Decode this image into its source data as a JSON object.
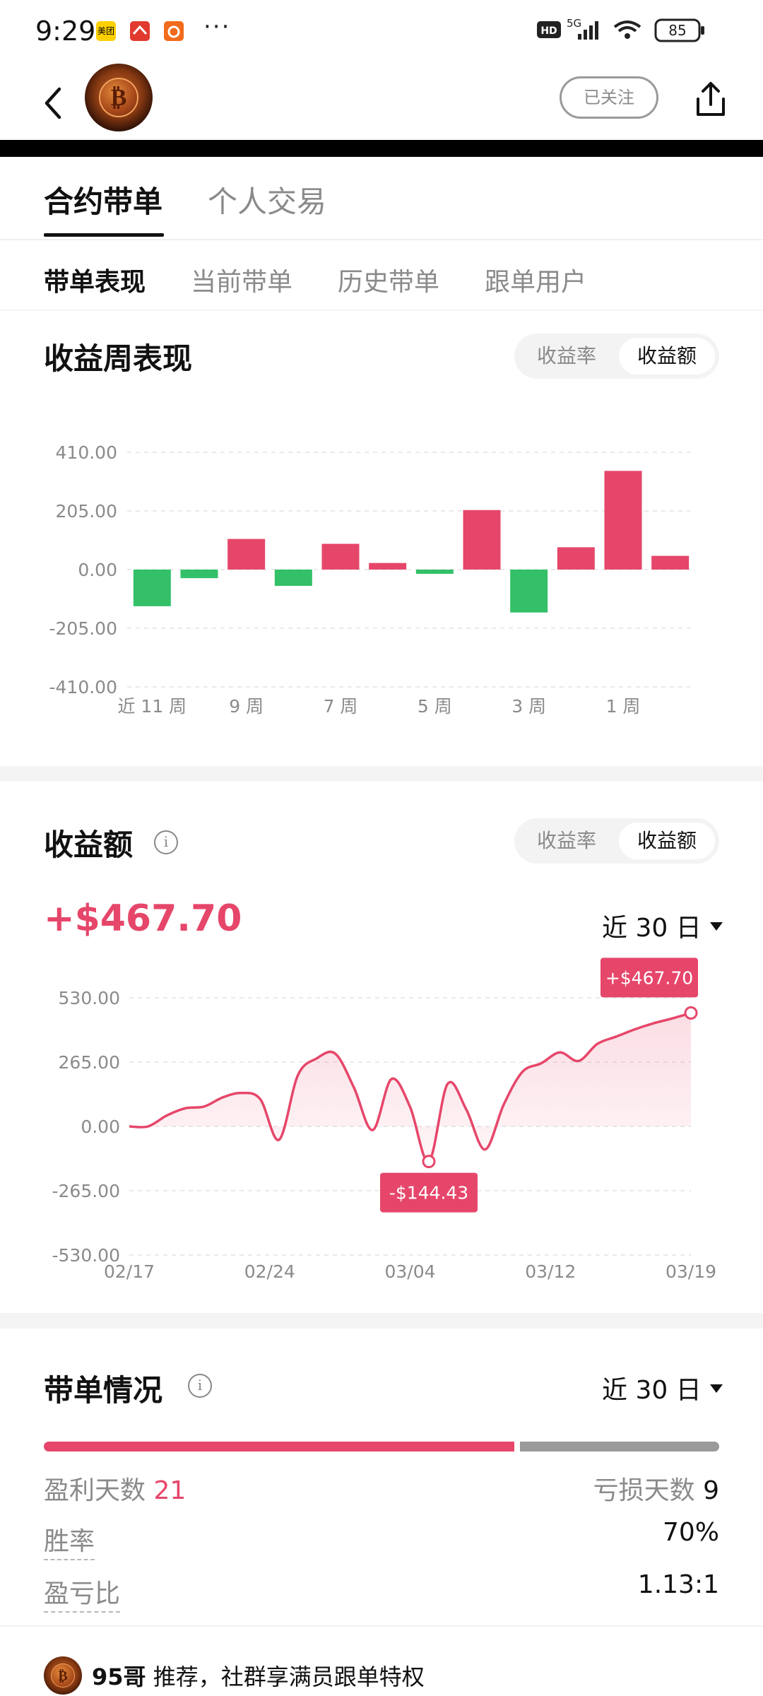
{
  "status_bar": {
    "time": "9:29",
    "app_icons": [
      {
        "name": "meituan-icon",
        "text": "美团",
        "color": "#ffd000"
      },
      {
        "name": "app-red-icon",
        "text": "",
        "color": "#e23a2e"
      },
      {
        "name": "app-orange-icon",
        "text": "",
        "color": "#f26a1b"
      }
    ],
    "more": "···",
    "hd": "HD",
    "network": "5G",
    "battery": "85"
  },
  "nav": {
    "follow_label": "已关注"
  },
  "main_tabs": [
    {
      "label": "合约带单",
      "active": true
    },
    {
      "label": "个人交易",
      "active": false
    }
  ],
  "sub_tabs": [
    {
      "label": "带单表现",
      "active": true
    },
    {
      "label": "当前带单",
      "active": false
    },
    {
      "label": "历史带单",
      "active": false
    },
    {
      "label": "跟单用户",
      "active": false
    }
  ],
  "weekly": {
    "title": "收益周表现",
    "toggle": [
      "收益率",
      "收益额"
    ],
    "toggle_active": "收益额"
  },
  "earnings": {
    "title": "收益额",
    "toggle": [
      "收益率",
      "收益额"
    ],
    "toggle_active": "收益额",
    "value": "+$467.70",
    "period": "近 30 日"
  },
  "summary": {
    "title": "带单情况",
    "period": "近 30 日",
    "profit_days_label": "盈利天数",
    "profit_days": "21",
    "loss_days_label": "亏损天数",
    "loss_days": "9",
    "win_rate_label": "胜率",
    "win_rate": "70%",
    "pl_ratio_label": "盈亏比",
    "pl_ratio": "1.13:1",
    "win_fraction": 0.7
  },
  "promo": {
    "name": "95哥",
    "text": "推荐，社群享满员跟单特权"
  },
  "colors": {
    "profit": "#e6466a",
    "loss": "#33c068",
    "neutral": "#9a9a9a"
  },
  "chart_data": [
    {
      "type": "bar",
      "ylim": [
        -410,
        410
      ],
      "yticks": [
        "410.00",
        "205.00",
        "0.00",
        "-205.00",
        "-410.00"
      ],
      "ytick_values": [
        410,
        205,
        0,
        -205,
        -410
      ],
      "x_tick_labels": [
        "近 11 周",
        "9 周",
        "7 周",
        "5 周",
        "3 周",
        "1 周"
      ],
      "x_tick_indices": [
        0,
        2,
        4,
        6,
        8,
        10
      ],
      "values": [
        -128,
        -30,
        107,
        -57,
        90,
        23,
        -15,
        208,
        -150,
        78,
        345,
        48
      ],
      "grid": true
    },
    {
      "type": "area",
      "ylim": [
        -530,
        530
      ],
      "yticks": [
        "530.00",
        "265.00",
        "0.00",
        "-265.00",
        "-530.00"
      ],
      "ytick_values": [
        530,
        265,
        0,
        -265,
        -530
      ],
      "x_tick_labels": [
        "02/17",
        "02/24",
        "03/04",
        "03/12",
        "03/19"
      ],
      "x": [
        "02/17",
        "02/18",
        "02/19",
        "02/20",
        "02/21",
        "02/22",
        "02/23",
        "02/24",
        "02/25",
        "02/26",
        "02/27",
        "02/28",
        "03/01",
        "03/02",
        "03/03",
        "03/04",
        "03/05",
        "03/06",
        "03/07",
        "03/08",
        "03/09",
        "03/10",
        "03/11",
        "03/12",
        "03/13",
        "03/14",
        "03/15",
        "03/16",
        "03/17",
        "03/18",
        "03/19"
      ],
      "values": [
        0,
        0,
        45,
        75,
        82,
        120,
        138,
        112,
        -55,
        210,
        280,
        300,
        160,
        -15,
        195,
        80,
        -144.43,
        175,
        70,
        -95,
        90,
        225,
        260,
        305,
        270,
        340,
        370,
        400,
        425,
        445,
        467.7
      ],
      "annotations": [
        {
          "label": "+$467.70",
          "index": 30
        },
        {
          "label": "-$144.43",
          "index": 16
        }
      ],
      "grid": true
    }
  ]
}
